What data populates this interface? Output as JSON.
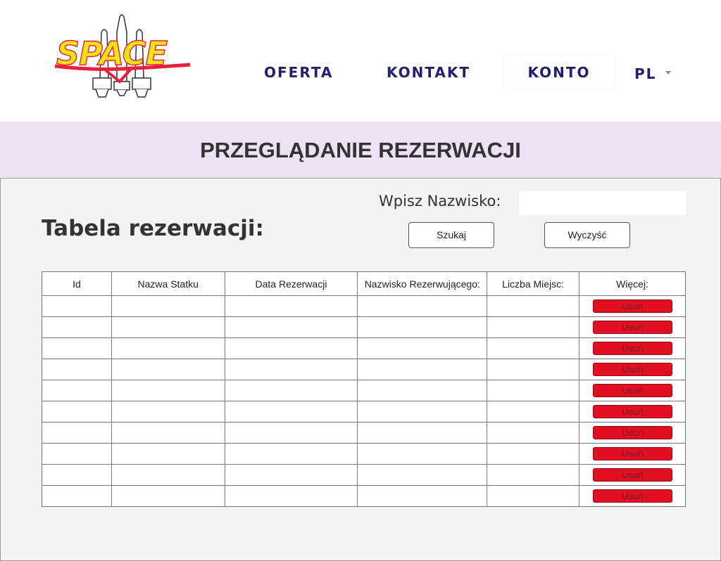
{
  "header": {
    "logo_text": "SPACE",
    "nav": {
      "oferta": "OFERTA",
      "kontakt": "KONTAKT",
      "konto": "KONTO",
      "lang": "PL"
    }
  },
  "title_band": {
    "title": "PRZEGLĄDANIE REZERWACJI"
  },
  "main": {
    "table_heading": "Tabela rezerwacji:",
    "search": {
      "label": "Wpisz Nazwisko:",
      "value": "",
      "search_button": "Szukaj",
      "clear_button": "Wyczyść"
    },
    "table": {
      "columns": [
        "Id",
        "Nazwa Statku",
        "Data Rezerwacji",
        "Nazwisko Rezerwującego:",
        "Liczba Miejsc:",
        "Więcej:"
      ],
      "delete_label": "Usuń",
      "rows": [
        [
          "",
          "",
          "",
          "",
          ""
        ],
        [
          "",
          "",
          "",
          "",
          ""
        ],
        [
          "",
          "",
          "",
          "",
          ""
        ],
        [
          "",
          "",
          "",
          "",
          ""
        ],
        [
          "",
          "",
          "",
          "",
          ""
        ],
        [
          "",
          "",
          "",
          "",
          ""
        ],
        [
          "",
          "",
          "",
          "",
          ""
        ],
        [
          "",
          "",
          "",
          "",
          ""
        ],
        [
          "",
          "",
          "",
          "",
          ""
        ],
        [
          "",
          "",
          "",
          "",
          ""
        ]
      ]
    }
  },
  "colors": {
    "nav_text": "#241e6e",
    "title_band": "#ede1f4",
    "delete_button": "#e01022",
    "panel_bg": "#f3f3f3"
  }
}
